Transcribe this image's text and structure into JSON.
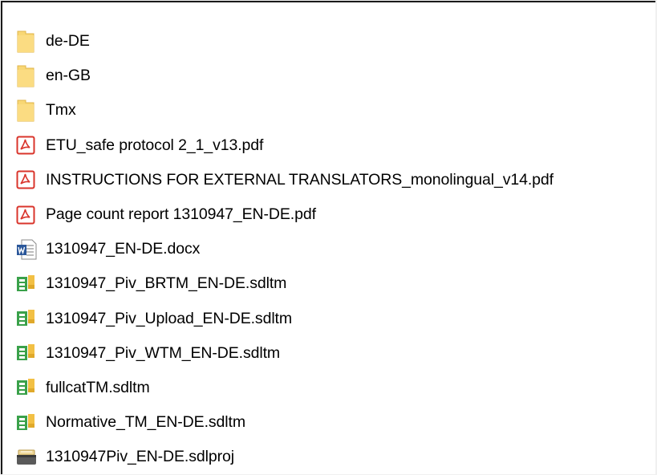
{
  "files": [
    {
      "name": "de-DE",
      "icon": "folder-icon"
    },
    {
      "name": "en-GB",
      "icon": "folder-icon"
    },
    {
      "name": "Tmx",
      "icon": "folder-icon"
    },
    {
      "name": "ETU_safe protocol 2_1_v13.pdf",
      "icon": "pdf-icon"
    },
    {
      "name": "INSTRUCTIONS FOR EXTERNAL TRANSLATORS_monolingual_v14.pdf",
      "icon": "pdf-icon"
    },
    {
      "name": "Page count report 1310947_EN-DE.pdf",
      "icon": "pdf-icon"
    },
    {
      "name": "1310947_EN-DE.docx",
      "icon": "word-document-icon"
    },
    {
      "name": "1310947_Piv_BRTM_EN-DE.sdltm",
      "icon": "sdltm-icon"
    },
    {
      "name": "1310947_Piv_Upload_EN-DE.sdltm",
      "icon": "sdltm-icon"
    },
    {
      "name": "1310947_Piv_WTM_EN-DE.sdltm",
      "icon": "sdltm-icon"
    },
    {
      "name": "fullcatTM.sdltm",
      "icon": "sdltm-icon"
    },
    {
      "name": "Normative_TM_EN-DE.sdltm",
      "icon": "sdltm-icon"
    },
    {
      "name": "1310947Piv_EN-DE.sdlproj",
      "icon": "sdlproj-icon"
    }
  ],
  "colors": {
    "folder": "#f8d775",
    "pdf": "#d9342b",
    "word": "#2b579a",
    "sdltm": "#3aa14a"
  }
}
